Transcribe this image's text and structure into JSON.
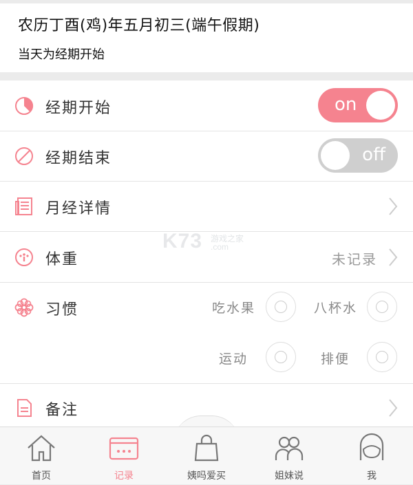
{
  "header": {
    "date_line": "农历丁酉(鸡)年五月初三(端午假期)",
    "status_line": "当天为经期开始"
  },
  "rows": {
    "period_start": {
      "label": "经期开始",
      "toggle_text": "on",
      "toggle_on": true
    },
    "period_end": {
      "label": "经期结束",
      "toggle_text": "off",
      "toggle_on": false
    },
    "menstrual_details": {
      "label": "月经详情"
    },
    "weight": {
      "label": "体重",
      "value": "未记录"
    },
    "habits": {
      "label": "习惯",
      "items": [
        "吃水果",
        "八杯水",
        "运动",
        "排便"
      ]
    },
    "notes": {
      "label": "备注"
    }
  },
  "watermark": {
    "main": "K73",
    "sub1": "游戏之家",
    "sub2": ".com"
  },
  "tabbar": {
    "items": [
      {
        "label": "首页",
        "icon": "home-icon"
      },
      {
        "label": "记录",
        "icon": "record-card-icon",
        "active": true
      },
      {
        "label": "姨吗爱买",
        "icon": "shopping-bag-icon"
      },
      {
        "label": "姐妹说",
        "icon": "people-icon"
      },
      {
        "label": "我",
        "icon": "profile-icon"
      }
    ]
  },
  "colors": {
    "accent": "#f5838f",
    "toggle_off": "#cfcfcf",
    "background": "#ebebeb"
  }
}
